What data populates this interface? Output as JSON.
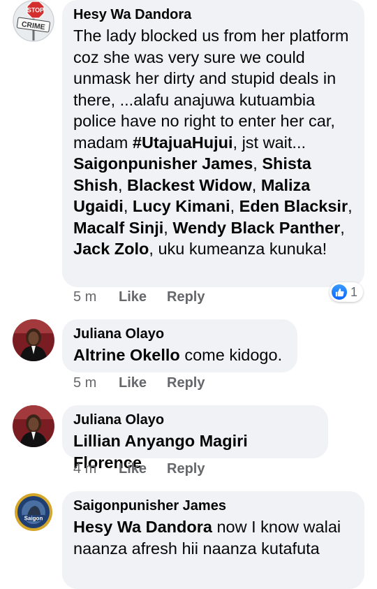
{
  "comments": [
    {
      "author": "Hesy Wa Dandora",
      "avatar_icon": "stop-crime-sign-icon",
      "avatar_text": {
        "top": "STOP",
        "bottom": "CRIME"
      },
      "text": [
        {
          "t": "The lady blocked us from her platform coz she was very sure we could unmask her dirty and stupid deals in there, ...alafu anajuwa kutuambia police have no right to enter her car, madam "
        },
        {
          "t": "#UtajuaHujui",
          "b": true
        },
        {
          "t": ", jst wait... "
        },
        {
          "t": "Saigonpunisher James",
          "b": true
        },
        {
          "t": ", "
        },
        {
          "t": "Shista Shish",
          "b": true
        },
        {
          "t": ", "
        },
        {
          "t": "Blackest Widow",
          "b": true
        },
        {
          "t": ", "
        },
        {
          "t": "Maliza Ugaidi",
          "b": true
        },
        {
          "t": ", "
        },
        {
          "t": "Lucy Kimani",
          "b": true
        },
        {
          "t": ", "
        },
        {
          "t": "Eden Blacksir",
          "b": true
        },
        {
          "t": ", "
        },
        {
          "t": "Macalf Sinji",
          "b": true
        },
        {
          "t": ", "
        },
        {
          "t": "Wendy Black Panther",
          "b": true
        },
        {
          "t": ", "
        },
        {
          "t": "Jack Zolo",
          "b": true
        },
        {
          "t": ", uku kumeanza kunuka!"
        }
      ],
      "time": "5 m",
      "like_label": "Like",
      "reply_label": "Reply",
      "reactions": {
        "icon": "thumbs-up-icon",
        "count": "1"
      }
    },
    {
      "author": "Juliana Olayo",
      "avatar_icon": "profile-photo",
      "text": [
        {
          "t": "Altrine Okello",
          "b": true
        },
        {
          "t": " come kidogo."
        }
      ],
      "time": "5 m",
      "like_label": "Like",
      "reply_label": "Reply"
    },
    {
      "author": "Juliana Olayo",
      "avatar_icon": "profile-photo",
      "text": [
        {
          "t": "Lillian Anyango Magiri Florence",
          "b": true
        }
      ],
      "time": "4 m",
      "like_label": "Like",
      "reply_label": "Reply"
    },
    {
      "author": "Saigonpunisher James",
      "avatar_icon": "saigon-badge-icon",
      "avatar_text": {
        "center": "Saigon"
      },
      "text": [
        {
          "t": "Hesy Wa Dandora",
          "b": true
        },
        {
          "t": " now I know walai naanza afresh hii naanza kutafuta"
        }
      ]
    }
  ],
  "colors": {
    "bubble": "#f0f2f5",
    "meta": "#65676b",
    "like_blue": "#0866ff"
  }
}
